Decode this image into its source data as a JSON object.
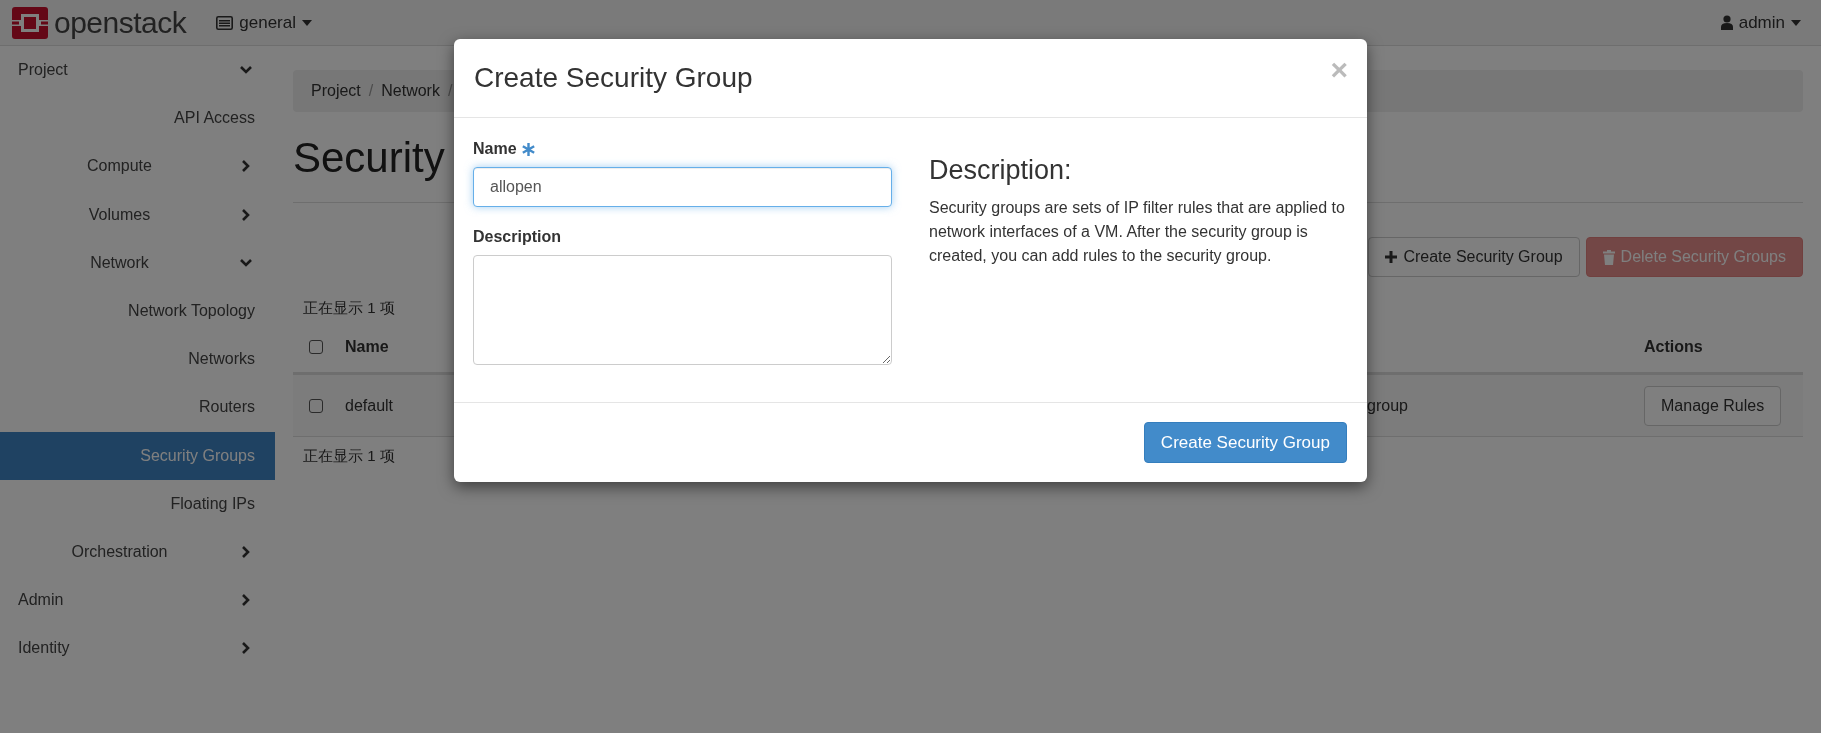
{
  "topbar": {
    "brand": "openstack",
    "project_menu": "general",
    "user_menu": "admin"
  },
  "sidebar": {
    "items": [
      {
        "label": "Project",
        "expanded": true,
        "children": [
          {
            "label": "API Access",
            "selected": false
          },
          {
            "label": "Compute",
            "expanded": false
          },
          {
            "label": "Volumes",
            "expanded": false
          },
          {
            "label": "Network",
            "expanded": true,
            "children": [
              {
                "label": "Network Topology",
                "selected": false
              },
              {
                "label": "Networks",
                "selected": false
              },
              {
                "label": "Routers",
                "selected": false
              },
              {
                "label": "Security Groups",
                "selected": true
              },
              {
                "label": "Floating IPs",
                "selected": false
              }
            ]
          },
          {
            "label": "Orchestration",
            "expanded": false
          }
        ]
      },
      {
        "label": "Admin",
        "expanded": false
      },
      {
        "label": "Identity",
        "expanded": false
      }
    ]
  },
  "breadcrumb": [
    {
      "label": "Project",
      "separator": "/"
    },
    {
      "label": "Network",
      "separator": "/"
    }
  ],
  "page_title": "Security",
  "toolbar": {
    "create_button": "Create Security Group",
    "delete_button": "Delete Security Groups",
    "delete_disabled": true
  },
  "item_count_top": "正在显示 1 项",
  "table": {
    "select_all_checked": false,
    "header_name": "Name",
    "header_actions": "Actions",
    "rows": [
      {
        "checked": false,
        "name": "default",
        "description": "group",
        "action": "Manage Rules"
      }
    ]
  },
  "item_count_bottom": "正在显示 1 项",
  "modal": {
    "title": "Create Security Group",
    "close": "×",
    "name_label": "Name",
    "name_required": true,
    "name_value": "allopen",
    "description_label": "Description",
    "help_heading": "Description:",
    "help_text": "Security groups are sets of IP filter rules that are applied to network interfaces of a VM. After the security group is created, you can add rules to the security group.",
    "submit_button": "Create Security Group"
  }
}
